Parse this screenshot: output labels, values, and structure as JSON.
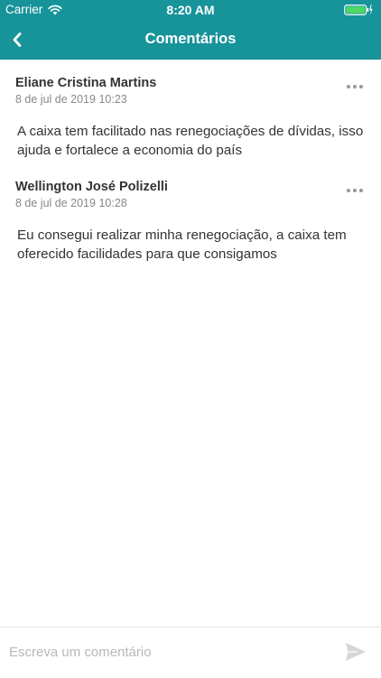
{
  "status_bar": {
    "carrier": "Carrier",
    "time": "8:20 AM"
  },
  "nav": {
    "title": "Comentários"
  },
  "comments": [
    {
      "author": "Eliane Cristina Martins",
      "date": "8 de jul de 2019 10:23",
      "text": "A caixa tem facilitado nas renegociações de dívidas, isso ajuda e fortalece a economia do país"
    },
    {
      "author": "Wellington José Polizelli",
      "date": "8 de jul de 2019 10:28",
      "text": "Eu consegui realizar minha renegociação, a caixa tem oferecido facilidades para que consigamos"
    }
  ],
  "composer": {
    "placeholder": "Escreva um comentário"
  },
  "colors": {
    "header": "#17939a",
    "battery": "#4cd964"
  },
  "icons": [
    "wifi-icon",
    "battery-icon",
    "back-chevron-icon",
    "more-dots-icon",
    "send-icon"
  ]
}
